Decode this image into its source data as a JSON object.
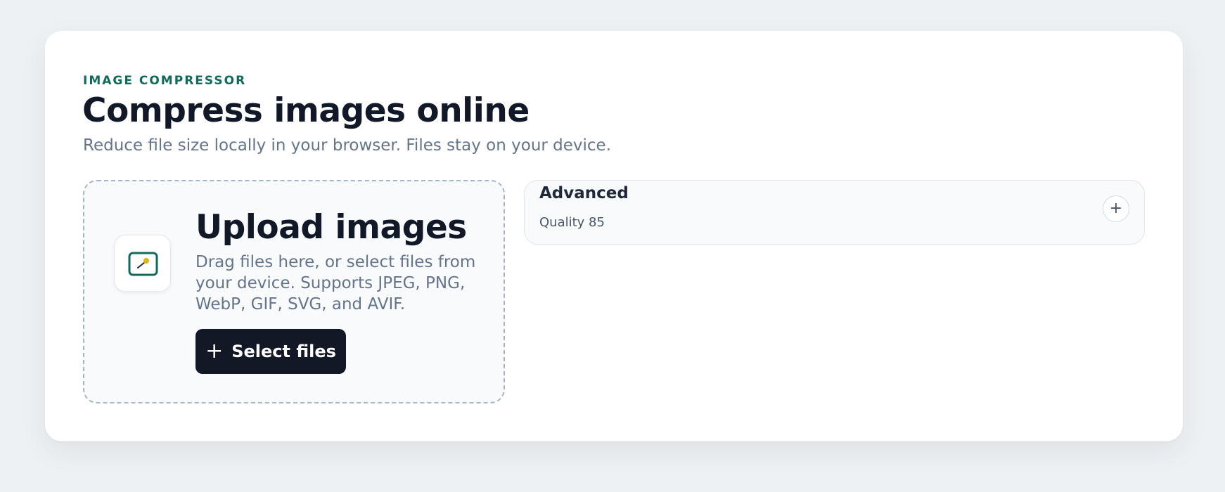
{
  "header": {
    "eyebrow": "IMAGE COMPRESSOR",
    "title": "Compress images online",
    "subtitle": "Reduce file size locally in your browser. Files stay on your device."
  },
  "upload": {
    "icon": "image-icon",
    "title": "Upload images",
    "description": "Drag files here, or select files from your device. Supports JPEG, PNG, WebP, GIF, SVG, and AVIF.",
    "button_icon": "plus-icon",
    "button_label": "Select files"
  },
  "advanced": {
    "title": "Advanced",
    "summary": "Quality 85",
    "toggle_symbol": "+",
    "toggle_icon": "plus-icon"
  },
  "colors": {
    "page_background": "#eef1f4",
    "accent": "#0f6b5a",
    "primary_button": "#121826",
    "muted_text": "#64748b",
    "image_icon_dot": "#e3b505"
  }
}
